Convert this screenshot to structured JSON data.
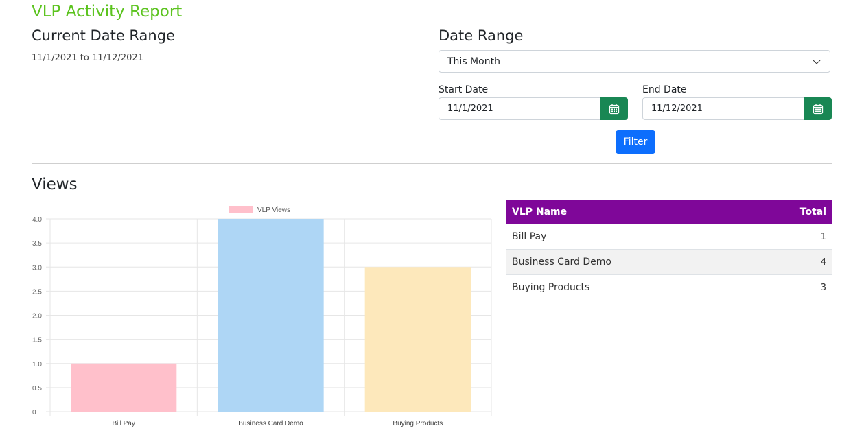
{
  "header": {
    "title": "VLP Activity Report",
    "current_range_heading": "Current Date Range",
    "current_range_value": "11/1/2021 to 11/12/2021"
  },
  "filters": {
    "date_range_heading": "Date Range",
    "range_select": {
      "selected": "This Month"
    },
    "start_date": {
      "label": "Start Date",
      "value": "11/1/2021"
    },
    "end_date": {
      "label": "End Date",
      "value": "11/12/2021"
    },
    "filter_label": "Filter"
  },
  "views": {
    "heading": "Views",
    "table": {
      "columns": [
        "VLP Name",
        "Total"
      ],
      "rows": [
        {
          "name": "Bill Pay",
          "total": "1"
        },
        {
          "name": "Business Card Demo",
          "total": "4"
        },
        {
          "name": "Buying Products",
          "total": "3"
        }
      ],
      "header_color": "#7f0799"
    }
  },
  "icons": {
    "calendar": "calendar-icon",
    "dropdown": "chevron-down-icon"
  },
  "colors": {
    "title": "#5cc31f",
    "calendar_button": "#198754",
    "filter_button": "#0d6efd"
  },
  "chart_data": {
    "type": "bar",
    "categories": [
      "Bill Pay",
      "Business Card Demo",
      "Buying Products"
    ],
    "series": [
      {
        "name": "VLP Views",
        "values": [
          1,
          4,
          3
        ]
      }
    ],
    "bar_colors": [
      "#ffc0cb",
      "#aed6f5",
      "#fde8bb"
    ],
    "legend_color": "#ffc0cb",
    "ylim": [
      0,
      4
    ],
    "yticks": [
      "0",
      "0.5",
      "1.0",
      "1.5",
      "2.0",
      "2.5",
      "3.0",
      "3.5",
      "4.0"
    ],
    "grid": true,
    "legend_position": "top"
  }
}
